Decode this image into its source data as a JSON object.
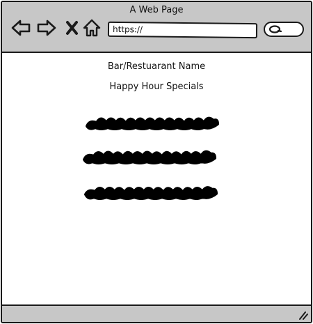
{
  "window": {
    "title": "A Web Page"
  },
  "toolbar": {
    "icons": [
      "back-arrow-icon",
      "forward-arrow-icon",
      "close-x-icon",
      "home-icon"
    ],
    "address_value": "https://",
    "search_icon": "magnifier-icon"
  },
  "page": {
    "restaurant_name": "Bar/Restuarant Name",
    "section_title": "Happy Hour Specials",
    "placeholder_lines": 3
  },
  "status": {
    "grip_icon": "resize-grip-icon"
  },
  "colors": {
    "chrome": "#c7c7c7",
    "ink": "#1a1a1a",
    "background": "#ffffff"
  }
}
